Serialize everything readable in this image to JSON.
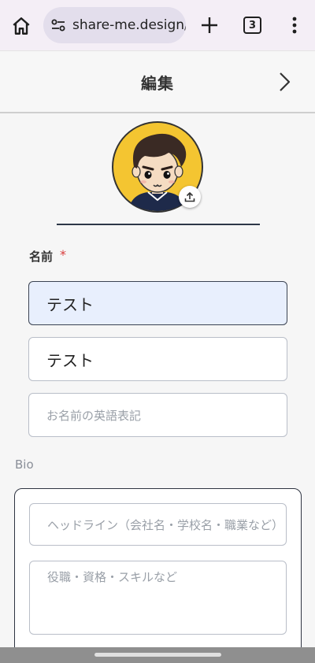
{
  "browser": {
    "url": "share-me.design/",
    "tab_count": "3"
  },
  "header": {
    "title": "編集"
  },
  "form": {
    "name_label": "名前",
    "required_mark": "*",
    "name_value": "テスト",
    "name_kana_value": "テスト",
    "name_english_placeholder": "お名前の英語表記",
    "bio_label": "Bio",
    "headline_placeholder": "ヘッドライン（会社名・学校名・職業など）",
    "role_placeholder": "役職・資格・スキルなど"
  },
  "icons": {
    "home": "home-icon",
    "site_settings": "tune-icon",
    "new_tab": "plus-icon",
    "menu": "more-vert-icon",
    "next": "chevron-right-icon",
    "upload": "upload-icon"
  },
  "colors": {
    "focused_field_bg": "#e8effd",
    "required": "#d93d3d",
    "avatar_ring": "#f4c531"
  }
}
